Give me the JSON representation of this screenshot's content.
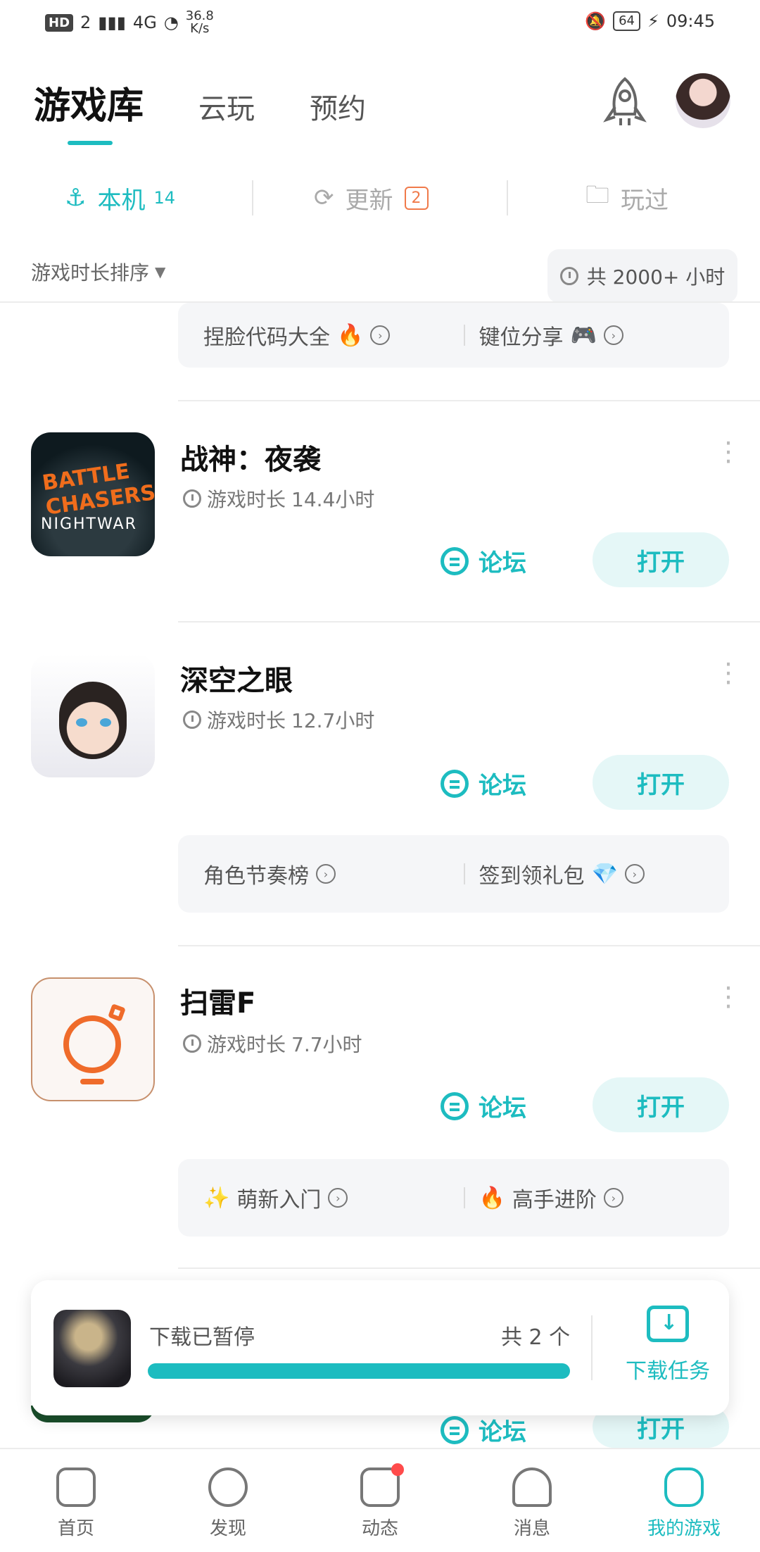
{
  "status_bar": {
    "hd": "HD",
    "sim": "2",
    "net": "4G",
    "speed": "36.8\nK/s",
    "battery": "64",
    "time": "09:45"
  },
  "top_tabs": {
    "main": "游戏库",
    "cloud": "云玩",
    "reserve": "预约"
  },
  "sub_tabs": {
    "local_label": "本机",
    "local_count": "14",
    "update_label": "更新",
    "update_count": "2",
    "played_label": "玩过"
  },
  "sort": {
    "label": "游戏时长排序",
    "total": "共 2000+ 小时"
  },
  "top_card": {
    "left": "捏脸代码大全",
    "right": "键位分享"
  },
  "games": [
    {
      "title": "战神：夜袭",
      "time_label": "游戏时长",
      "time_value": "14.4小时",
      "forum": "论坛",
      "open": "打开",
      "icon_text_1": "BATTLE CHASERS",
      "icon_text_2": "NIGHTWAR"
    },
    {
      "title": "深空之眼",
      "time_label": "游戏时长",
      "time_value": "12.7小时",
      "forum": "论坛",
      "open": "打开",
      "card_left": "角色节奏榜",
      "card_right": "签到领礼包"
    },
    {
      "title": "扫雷F",
      "time_label": "游戏时长",
      "time_value": "7.7小时",
      "forum": "论坛",
      "open": "打开",
      "card_left": "萌新入门",
      "card_right": "高手进阶"
    }
  ],
  "partial_row": {
    "forum": "论坛",
    "open": "打开"
  },
  "download": {
    "status": "下载已暂停",
    "count": "共 2 个",
    "task": "下载任务",
    "progress": 1.0
  },
  "bottom_nav": [
    {
      "label": "首页"
    },
    {
      "label": "发现"
    },
    {
      "label": "动态"
    },
    {
      "label": "消息"
    },
    {
      "label": "我的游戏"
    }
  ],
  "colors": {
    "accent": "#1dbcc0",
    "badge": "#f07a4a"
  }
}
